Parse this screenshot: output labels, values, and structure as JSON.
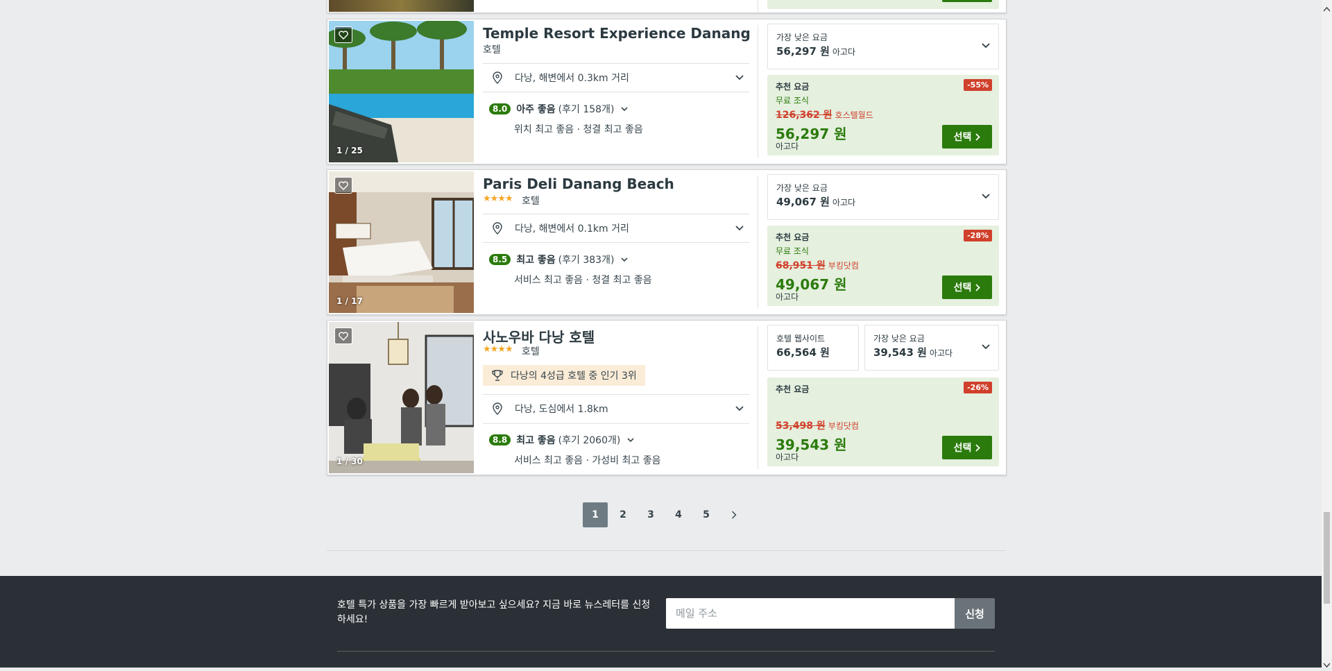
{
  "hotels": [
    {
      "name": "Temple Resort Experience Danang",
      "stars": "",
      "type": "호텔",
      "photo_counter": "1 / 25",
      "location": "다낭, 해변에서 0.3km 거리",
      "score": "8.0",
      "rating_label": "아주 좋음",
      "reviews": "(후기 158개)",
      "highlights": "위치 최고 좋음 · 청결 최고 좋음",
      "lowest_label": "가장 낮은 요금",
      "lowest_price": "56,297 원",
      "lowest_provider": "아고다",
      "rec_label": "추천 요금",
      "discount": "-55%",
      "feature": "무료 조식",
      "old_price": "126,362 원",
      "old_provider": "호스텔월드",
      "price": "56,297 원",
      "provider": "아고다",
      "select": "선택"
    },
    {
      "name": "Paris Deli Danang Beach",
      "stars": "★★★★",
      "type": "호텔",
      "photo_counter": "1 / 17",
      "location": "다낭, 해변에서 0.1km 거리",
      "score": "8.5",
      "rating_label": "최고 좋음",
      "reviews": "(후기 383개)",
      "highlights": "서비스 최고 좋음 · 청결 최고 좋음",
      "lowest_label": "가장 낮은 요금",
      "lowest_price": "49,067 원",
      "lowest_provider": "아고다",
      "rec_label": "추천 요금",
      "discount": "-28%",
      "feature": "무료 조식",
      "old_price": "68,951 원",
      "old_provider": "부킹닷컴",
      "price": "49,067 원",
      "provider": "아고다",
      "select": "선택"
    },
    {
      "name": "사노우바 다낭 호텔",
      "stars": "★★★★",
      "type": "호텔",
      "photo_counter": "1 / 30",
      "popular": "다낭의 4성급 호텔 중 인기 3위",
      "location": "다낭, 도심에서 1.8km",
      "score": "8.8",
      "rating_label": "최고 좋음",
      "reviews": "(후기 2060개)",
      "highlights": "서비스 최고 좋음 · 가성비 최고 좋음",
      "website_label": "호텔 웹사이트",
      "website_price": "66,564 원",
      "lowest_label": "가장 낮은 요금",
      "lowest_price": "39,543 원",
      "lowest_provider": "아고다",
      "rec_label": "추천 요금",
      "discount": "-26%",
      "old_price": "53,498 원",
      "old_provider": "부킹닷컴",
      "price": "39,543 원",
      "provider": "아고다",
      "select": "선택"
    }
  ],
  "pagination": {
    "pages": [
      "1",
      "2",
      "3",
      "4",
      "5"
    ],
    "current": "1"
  },
  "newsletter": {
    "text": "호텔 특가 상품을 가장 빠르게 받아보고 싶으세요? 지금 바로 뉴스레터를 신청하세요!",
    "placeholder": "메일 주소",
    "button": "신청"
  },
  "colors": {
    "green": "#2b7b0c",
    "discount_red": "#d0402b",
    "footer": "#2b3036"
  }
}
